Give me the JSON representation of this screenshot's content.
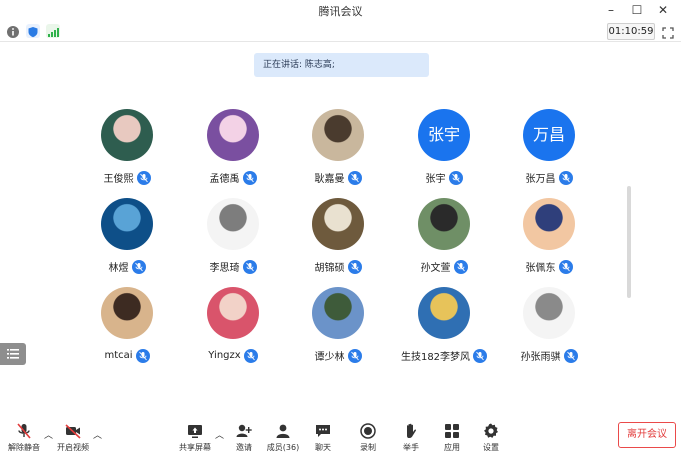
{
  "window": {
    "title": "腾讯会议",
    "minimize": "–",
    "maximize": "☐",
    "close": "✕"
  },
  "infobar": {
    "timer": "01:10:59"
  },
  "speaker_banner": "正在讲话: 陈志高;",
  "participants": [
    {
      "name": "王俊熙",
      "avatar": "photo",
      "colors": [
        "#2e5d4f",
        "#e8c9c0"
      ]
    },
    {
      "name": "孟德禹",
      "avatar": "photo",
      "colors": [
        "#7a4fa0",
        "#f3d2e6"
      ]
    },
    {
      "name": "耿嘉曼",
      "avatar": "photo",
      "colors": [
        "#c9b79d",
        "#4a3b2e"
      ]
    },
    {
      "name": "张宇",
      "avatar": "text",
      "text": "张宇"
    },
    {
      "name": "张万昌",
      "avatar": "text",
      "text": "万昌"
    },
    {
      "name": "林煜",
      "avatar": "photo",
      "colors": [
        "#0e4f88",
        "#59a3d6"
      ]
    },
    {
      "name": "李思琦",
      "avatar": "photo",
      "colors": [
        "#f4f4f4",
        "#7d7d7d"
      ]
    },
    {
      "name": "胡锦硕",
      "avatar": "photo",
      "colors": [
        "#6e5a3d",
        "#e9e1d0"
      ]
    },
    {
      "name": "孙文萱",
      "avatar": "photo",
      "colors": [
        "#6f8f66",
        "#2a2a2a"
      ]
    },
    {
      "name": "张佩东",
      "avatar": "photo",
      "colors": [
        "#f2c7a2",
        "#2f3f7b"
      ]
    },
    {
      "name": "mtcai",
      "avatar": "photo",
      "colors": [
        "#d8b48c",
        "#3d2b22"
      ]
    },
    {
      "name": "Yingzx",
      "avatar": "photo",
      "colors": [
        "#d9546b",
        "#f2d2c8"
      ]
    },
    {
      "name": "谭少林",
      "avatar": "photo",
      "colors": [
        "#6b93c9",
        "#3e5b3a"
      ]
    },
    {
      "name": "生技182李梦风",
      "avatar": "photo",
      "colors": [
        "#2f6fb3",
        "#e7c35a"
      ]
    },
    {
      "name": "孙张雨骐",
      "avatar": "photo",
      "colors": [
        "#f4f4f4",
        "#8a8a8a"
      ]
    }
  ],
  "toolbar": {
    "mute": "解除静音",
    "video": "开启视频",
    "share": "共享屏幕",
    "invite": "邀请",
    "members": "成员(36)",
    "chat": "聊天",
    "record": "录制",
    "raise_hand": "举手",
    "apps": "应用",
    "settings": "设置",
    "leave": "离开会议"
  }
}
